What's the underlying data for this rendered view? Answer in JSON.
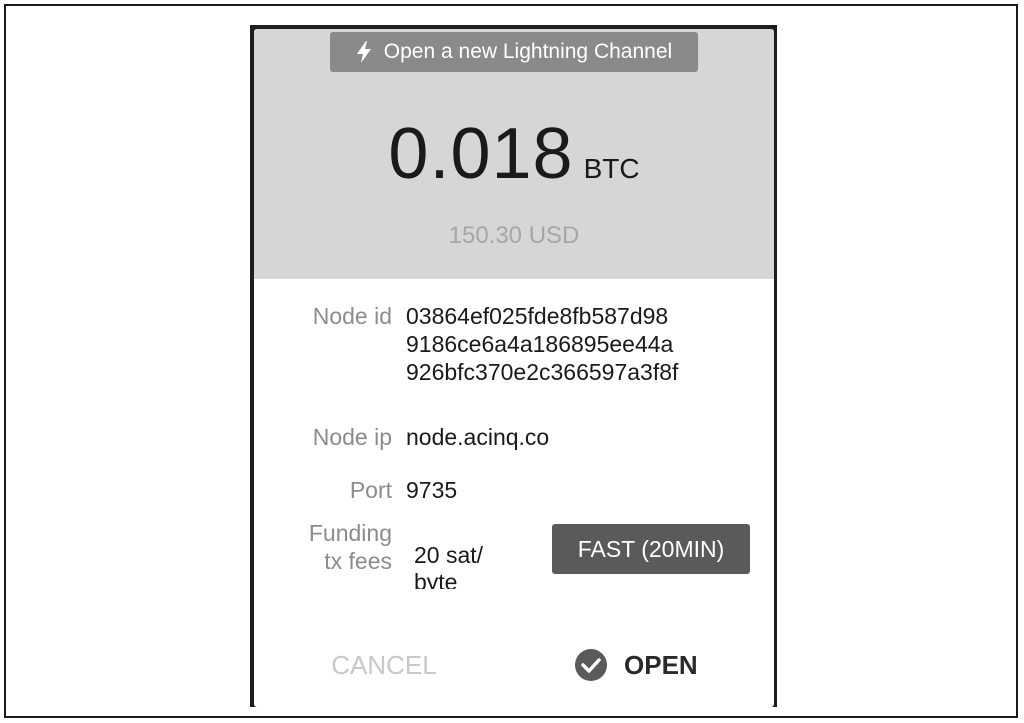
{
  "dialog": {
    "title": "Open a new Lightning Channel",
    "title_icon": "lightning-bolt-icon",
    "amount": "0.018",
    "unit": "BTC",
    "fiat": "150.30 USD"
  },
  "fields": {
    "node_id": {
      "label": "Node id",
      "lines": [
        "03864ef025fde8fb587d98",
        "9186ce6a4a186895ee44a",
        "926bfc370e2c366597a3f8f"
      ]
    },
    "node_ip": {
      "label": "Node ip",
      "value": "node.acinq.co"
    },
    "port": {
      "label": "Port",
      "value": "9735"
    },
    "funding_fees": {
      "label_line1": "Funding",
      "label_line2": "tx fees",
      "value_line1": "20 sat/",
      "value_line2": "byte",
      "speed_button": "FAST (20MIN)"
    }
  },
  "actions": {
    "cancel": "CANCEL",
    "open": "OPEN",
    "open_icon": "check-circle-icon"
  },
  "colors": {
    "header_bg": "#d6d6d6",
    "chip_bg": "#8a8a8a",
    "button_bg": "#5a5a5a",
    "muted_text": "#8c8c8c"
  }
}
